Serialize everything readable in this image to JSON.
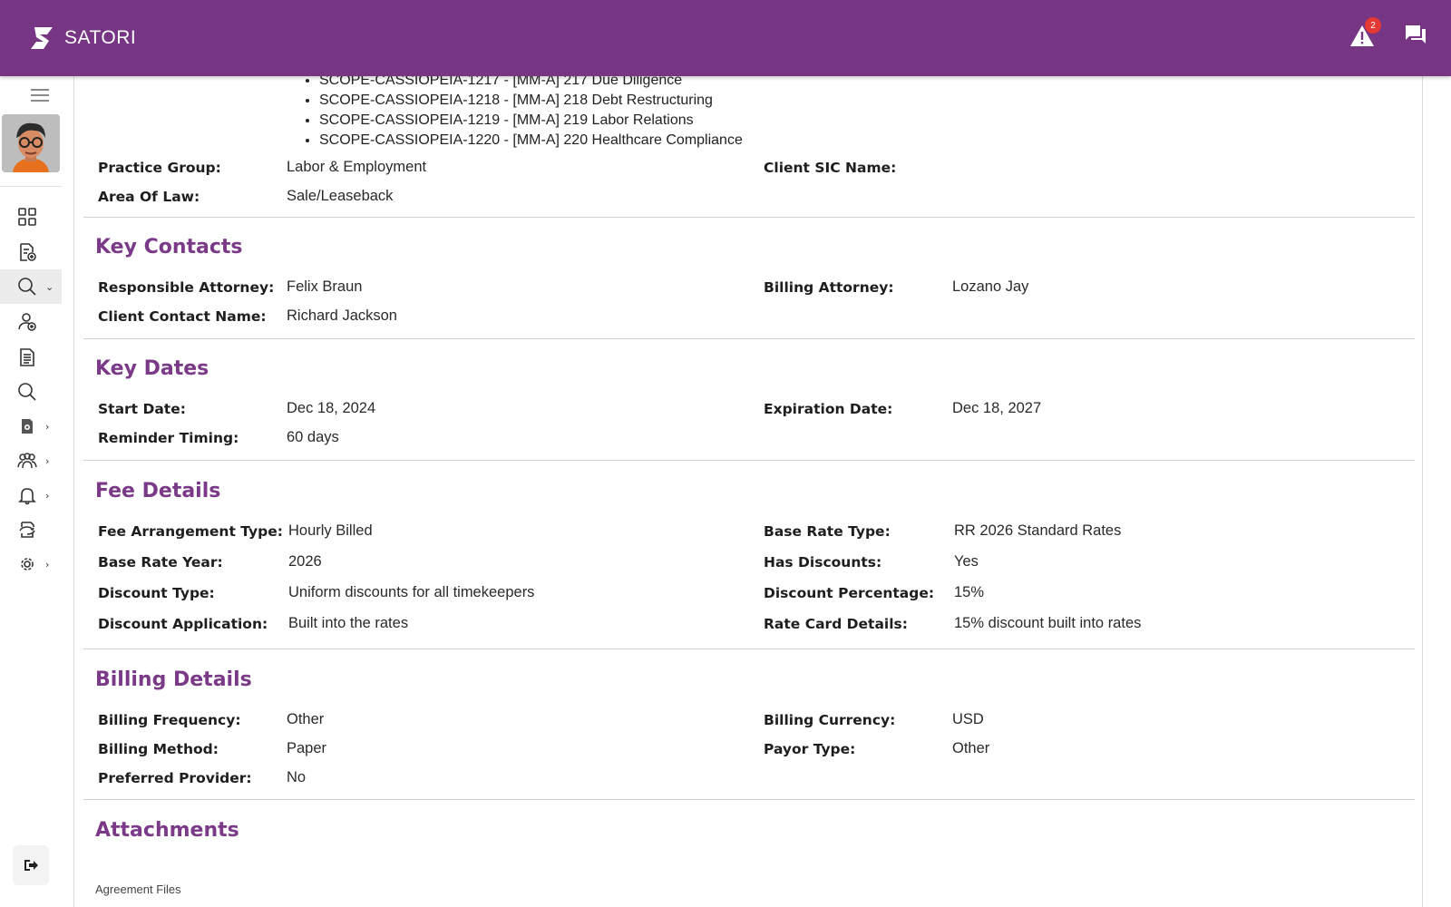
{
  "app": {
    "name": "SATORI"
  },
  "header": {
    "alert_count": "2",
    "colors": {
      "bar": "#763683",
      "badge": "#e53935"
    }
  },
  "sidebar": {
    "items": [
      {
        "icon": "dashboard-grid-icon",
        "chevron": false
      },
      {
        "icon": "document-add-icon",
        "chevron": false
      },
      {
        "icon": "search-icon",
        "chevron": true,
        "active": true
      },
      {
        "icon": "user-add-icon",
        "chevron": false
      },
      {
        "icon": "document-list-icon",
        "chevron": false
      },
      {
        "icon": "search-icon",
        "chevron": false
      },
      {
        "icon": "file-lock-icon",
        "chevron": true
      },
      {
        "icon": "users-group-icon",
        "chevron": true
      },
      {
        "icon": "bell-icon",
        "chevron": true
      },
      {
        "icon": "sync-document-icon",
        "chevron": false
      },
      {
        "icon": "gear-icon",
        "chevron": true
      }
    ],
    "logout_icon": "logout-icon"
  },
  "scope_items": [
    "SCOPE-CASSIOPEIA-1217 - [MM-A] 217 Due Diligence",
    "SCOPE-CASSIOPEIA-1218 - [MM-A] 218 Debt Restructuring",
    "SCOPE-CASSIOPEIA-1219 - [MM-A] 219 Labor Relations",
    "SCOPE-CASSIOPEIA-1220 - [MM-A] 220 Healthcare Compliance"
  ],
  "general": {
    "practice_group_label": "Practice Group:",
    "practice_group": "Labor & Employment",
    "client_sic_label": "Client SIC Name:",
    "client_sic": "",
    "area_of_law_label": "Area Of Law:",
    "area_of_law": "Sale/Leaseback"
  },
  "key_contacts": {
    "title": "Key Contacts",
    "responsible_attorney_label": "Responsible Attorney:",
    "responsible_attorney": "Felix Braun",
    "billing_attorney_label": "Billing Attorney:",
    "billing_attorney": "Lozano Jay",
    "client_contact_label": "Client Contact Name:",
    "client_contact": "Richard Jackson"
  },
  "key_dates": {
    "title": "Key Dates",
    "start_date_label": "Start Date:",
    "start_date": "Dec 18, 2024",
    "expiration_date_label": "Expiration Date:",
    "expiration_date": "Dec 18, 2027",
    "reminder_timing_label": "Reminder Timing:",
    "reminder_timing": "60 days"
  },
  "fee_details": {
    "title": "Fee Details",
    "fee_arrangement_label": "Fee Arrangement Type:",
    "fee_arrangement": "Hourly Billed",
    "base_rate_type_label": "Base Rate Type:",
    "base_rate_type": "RR 2026 Standard Rates",
    "base_rate_year_label": "Base Rate Year:",
    "base_rate_year": "2026",
    "has_discounts_label": "Has Discounts:",
    "has_discounts": "Yes",
    "discount_type_label": "Discount Type:",
    "discount_type": "Uniform discounts for all timekeepers",
    "discount_percentage_label": "Discount Percentage:",
    "discount_percentage": "15%",
    "discount_application_label": "Discount Application:",
    "discount_application": "Built into the rates",
    "rate_card_label": "Rate Card Details:",
    "rate_card": "15% discount built into rates"
  },
  "billing_details": {
    "title": "Billing Details",
    "frequency_label": "Billing Frequency:",
    "frequency": "Other",
    "currency_label": "Billing Currency:",
    "currency": "USD",
    "method_label": "Billing Method:",
    "method": "Paper",
    "payor_type_label": "Payor Type:",
    "payor_type": "Other",
    "preferred_provider_label": "Preferred Provider:",
    "preferred_provider": "No"
  },
  "attachments": {
    "title": "Attachments",
    "agreement_files_label": "Agreement Files"
  }
}
